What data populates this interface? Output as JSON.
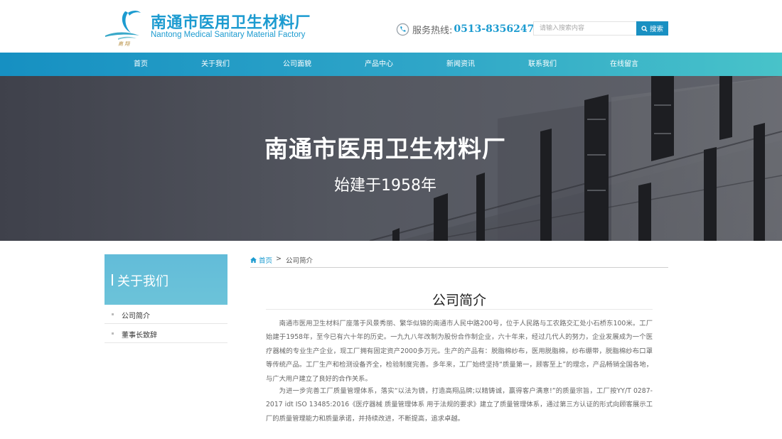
{
  "header": {
    "logo_cn": "南通市医用卫生材料厂",
    "logo_en": "Nantong Medical Sanitary Material Factory",
    "hotline_label": "服务热线:",
    "hotline_number": "0513-83562476",
    "search_placeholder": "请输入搜索内容",
    "search_button": "搜索"
  },
  "nav": [
    "首页",
    "关于我们",
    "公司面貌",
    "产品中心",
    "新闻资讯",
    "联系我们",
    "在线留言"
  ],
  "banner": {
    "title": "南通市医用卫生材料厂",
    "subtitle": "始建于1958年"
  },
  "sidebar": {
    "title": "关于我们",
    "items": [
      "公司简介",
      "董事长致辞"
    ]
  },
  "breadcrumb": {
    "home": "首页",
    "separator": ">",
    "current": "公司简介"
  },
  "content": {
    "title": "公司简介",
    "paragraphs": [
      "南通市医用卫生材料厂座落于风景秀丽、繁华似锦的南通市人民中路200号，位于人民路与工农路交汇处小石桥东100米。工厂始建于1958年，至今已有六十年的历史。一九九八年改制为股份合作制企业，六十年来，经过几代人的努力，企业发展成为一个医疗器械的专业生产企业，现工厂拥有固定资产2000多万元。生产的产品有：脱脂棉纱布，医用脱脂棉，纱布绷带，脱脂棉纱布口罩等传统产品。工厂生产和检测设备齐全，检验制度完善。多年来，工厂始终坚持“质量第一，顾客至上”的理念，产品畅销全国各地，与广大用户建立了良好的合作关系。",
      "为进一步完善工厂质量管理体系，落实“以法为镜，打造高翔品牌;以精铸诚，赢得客户满意!”的质量宗旨，工厂按YY/T 0287-2017 idt ISO 13485:2016《医疗器械 质量管理体系 用于法规的要求》建立了质量管理体系，通过第三方认证的形式向顾客展示工厂的质量管理能力和质量承诺，并持续改进，不断提高，追求卓越。"
    ]
  },
  "colors": {
    "brand": "#1c9bd0",
    "nav_start": "#1690c2",
    "nav_end": "#48c3c9",
    "sidebar_head": "#62bcd9"
  },
  "icons": {
    "hotline": "phone-icon",
    "search": "search-icon",
    "home": "home-icon",
    "logo": "crane-logo-icon"
  }
}
